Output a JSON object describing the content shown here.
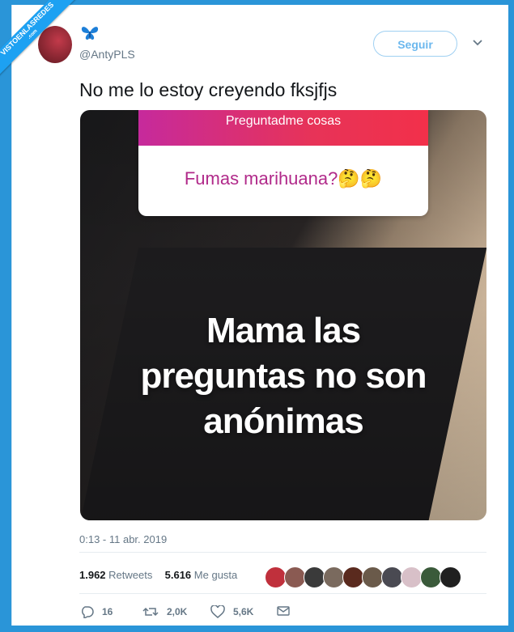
{
  "watermark": {
    "line1": "VISTOENLASREDES",
    "line2": ".com"
  },
  "account": {
    "handle": "@AntyPLS"
  },
  "follow_label": "Seguir",
  "tweet": {
    "text": "No me lo estoy creyendo fksjfjs",
    "timestamp": "0:13 - 11 abr. 2019"
  },
  "media": {
    "question_header": "Preguntadme cosas",
    "question_text": "Fumas marihuana?🤔🤔",
    "overlay_lines": [
      "Mama las",
      "preguntas no son",
      "anónimas"
    ]
  },
  "stats": {
    "retweets_count": "1.962",
    "retweets_label": "Retweets",
    "likes_count": "5.616",
    "likes_label": "Me gusta"
  },
  "likers": [
    "#c0303c",
    "#8a5a52",
    "#3a3a3a",
    "#7a6a5e",
    "#5a2a1e",
    "#6a5a4a",
    "#4a4a52",
    "#d8c0c8",
    "#3a5a3a",
    "#202020"
  ],
  "actions": {
    "replies": "16",
    "retweets": "2,0K",
    "likes": "5,6K"
  },
  "colors": {
    "background": "#2a95d8",
    "follow_border": "#9fd0f2",
    "follow_text": "#6cb8ee",
    "question_gradient": [
      "#c62a9c",
      "#f2304a"
    ]
  }
}
